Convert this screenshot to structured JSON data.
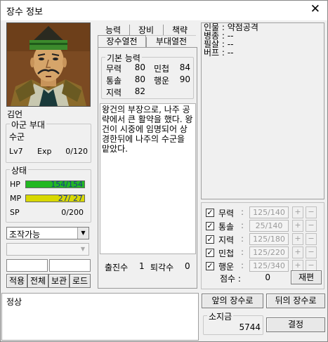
{
  "window": {
    "title": "장수 정보",
    "close": "✕"
  },
  "general": {
    "name": "김언",
    "army_group_title": "아군 부대",
    "army_name": "수군",
    "level": "Lv7",
    "exp_label": "Exp",
    "exp_value": "0/120"
  },
  "status": {
    "title": "상태",
    "hp_label": "HP",
    "hp_value": "154/154",
    "hp_fraction": 1.0,
    "mp_label": "MP",
    "mp_value": "27/ 27",
    "mp_fraction": 1.0,
    "sp_label": "SP",
    "sp_value": "0/200"
  },
  "controls": {
    "dropdown1_value": "조작가능",
    "dropdown2_value": "",
    "buttons": [
      "적용",
      "전체",
      "보관",
      "로드"
    ]
  },
  "tabs": {
    "row1": [
      "능력",
      "장비",
      "책략"
    ],
    "row2": [
      "장수열전",
      "부대열전"
    ]
  },
  "basic_stats": {
    "title": "기본 능력",
    "rows": [
      {
        "l1": "무력",
        "v1": "80",
        "l2": "민첩",
        "v2": "84"
      },
      {
        "l1": "통솔",
        "v1": "80",
        "l2": "행운",
        "v2": "90"
      },
      {
        "l1": "지력",
        "v1": "82",
        "l2": "",
        "v2": ""
      }
    ]
  },
  "biography": "왕건의 부장으로, 나주 공략에서 큰 활약을 했다. 왕건이 시중에 임명되어 상경한뒤에 나주의 수군을 맡았다.",
  "battle": {
    "sortie_label": "출진수",
    "sortie_value": "1",
    "retreat_label": "퇴각수",
    "retreat_value": "0"
  },
  "traits": {
    "lines": [
      {
        "label": "인물",
        "value": "약점공격"
      },
      {
        "label": "병종",
        "value": "--"
      },
      {
        "label": "필살",
        "value": "--"
      },
      {
        "label": "버프",
        "value": "--"
      }
    ]
  },
  "stat_edit": {
    "rows": [
      {
        "label": "무력",
        "value": "125/140",
        "checked": true
      },
      {
        "label": "통솔",
        "value": "25/140",
        "checked": true
      },
      {
        "label": "지력",
        "value": "125/180",
        "checked": true
      },
      {
        "label": "민첩",
        "value": "125/220",
        "checked": true
      },
      {
        "label": "행운",
        "value": "125/340",
        "checked": true
      }
    ],
    "colon": ":",
    "plus": "+",
    "minus": "−",
    "score_label": "점수 :",
    "score_value": "0",
    "reroll_button": "재편"
  },
  "footer": {
    "status_text": "정상",
    "prev_button": "앞의 장수로",
    "next_button": "뒤의 장수로",
    "gold_title": "소지금",
    "gold_value": "5744",
    "confirm_button": "결정"
  },
  "colors": {
    "hp": "#22b822",
    "mp": "#d8d800",
    "accent": "#f0f0f0"
  }
}
